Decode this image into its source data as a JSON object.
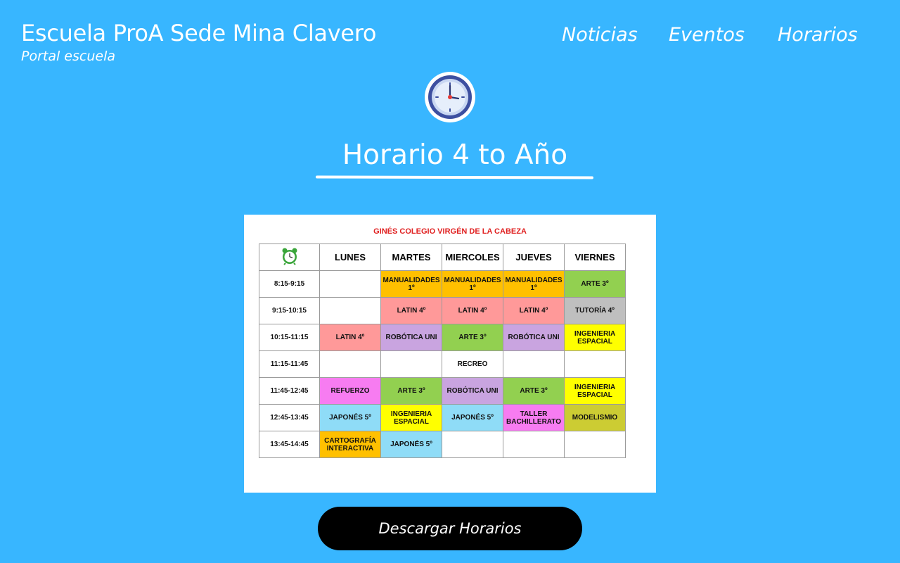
{
  "header": {
    "title": "Escuela ProA Sede Mina Clavero",
    "subtitle": "Portal escuela",
    "nav": [
      "Noticias",
      "Eventos",
      "Horarios"
    ]
  },
  "main": {
    "heading": "Horario 4 to Año",
    "icon": "clock-icon",
    "download_label": "Descargar Horarios"
  },
  "schedule": {
    "title": "GINÉS COLEGIO VIRGÉN DE LA CABEZA",
    "corner_icon": "alarm-clock-icon",
    "days": [
      "LUNES",
      "MARTES",
      "MIERCOLES",
      "JUEVES",
      "VIERNES"
    ],
    "rows": [
      {
        "time": "8:15-9:15",
        "cells": [
          {
            "text": "",
            "color": "#ffffff"
          },
          {
            "text": "MANUALIDADES 1º",
            "color": "#ffc000"
          },
          {
            "text": "MANUALIDADES 1º",
            "color": "#ffc000"
          },
          {
            "text": "MANUALIDADES 1º",
            "color": "#ffc000"
          },
          {
            "text": "ARTE 3º",
            "color": "#92d050"
          }
        ]
      },
      {
        "time": "9:15-10:15",
        "cells": [
          {
            "text": "",
            "color": "#ffffff"
          },
          {
            "text": "LATIN 4º",
            "color": "#ff9999"
          },
          {
            "text": "LATIN 4º",
            "color": "#ff9999"
          },
          {
            "text": "LATIN 4º",
            "color": "#ff9999"
          },
          {
            "text": "TUTORÍA 4º",
            "color": "#bfbfbf"
          }
        ]
      },
      {
        "time": "10:15-11:15",
        "cells": [
          {
            "text": "LATIN 4º",
            "color": "#ff9999"
          },
          {
            "text": "ROBÓTICA UNI",
            "color": "#c9a4e0"
          },
          {
            "text": "ARTE 3º",
            "color": "#92d050"
          },
          {
            "text": "ROBÓTICA UNI",
            "color": "#c9a4e0"
          },
          {
            "text": "INGENIERIA ESPACIAL",
            "color": "#ffff00"
          }
        ]
      },
      {
        "time": "11:15-11:45",
        "cells": [
          {
            "text": "",
            "color": "#ffffff"
          },
          {
            "text": "",
            "color": "#ffffff"
          },
          {
            "text": "RECREO",
            "color": "#ffffff"
          },
          {
            "text": "",
            "color": "#ffffff"
          },
          {
            "text": "",
            "color": "#ffffff"
          }
        ]
      },
      {
        "time": "11:45-12:45",
        "cells": [
          {
            "text": "REFUERZO",
            "color": "#f77cf1"
          },
          {
            "text": "ARTE 3º",
            "color": "#92d050"
          },
          {
            "text": "ROBÓTICA UNI",
            "color": "#c9a4e0"
          },
          {
            "text": "ARTE 3º",
            "color": "#92d050"
          },
          {
            "text": "INGENIERIA ESPACIAL",
            "color": "#ffff00"
          }
        ]
      },
      {
        "time": "12:45-13:45",
        "cells": [
          {
            "text": "JAPONÉS 5º",
            "color": "#8fdcf7"
          },
          {
            "text": "INGENIERIA ESPACIAL",
            "color": "#ffff00"
          },
          {
            "text": "JAPONÉS 5º",
            "color": "#8fdcf7"
          },
          {
            "text": "TALLER BACHILLERATO",
            "color": "#f77cf1"
          },
          {
            "text": "MODELISMIO",
            "color": "#cccc33"
          }
        ]
      },
      {
        "time": "13:45-14:45",
        "cells": [
          {
            "text": "CARTOGRAFÍA INTERACTIVA",
            "color": "#ffc000"
          },
          {
            "text": "JAPONÉS 5º",
            "color": "#8fdcf7"
          },
          {
            "text": "",
            "color": "#ffffff"
          },
          {
            "text": "",
            "color": "#ffffff"
          },
          {
            "text": "",
            "color": "#ffffff"
          }
        ]
      }
    ]
  },
  "colors": {
    "background": "#38b6ff",
    "button": "#000000",
    "sheet_title": "#e02020"
  }
}
